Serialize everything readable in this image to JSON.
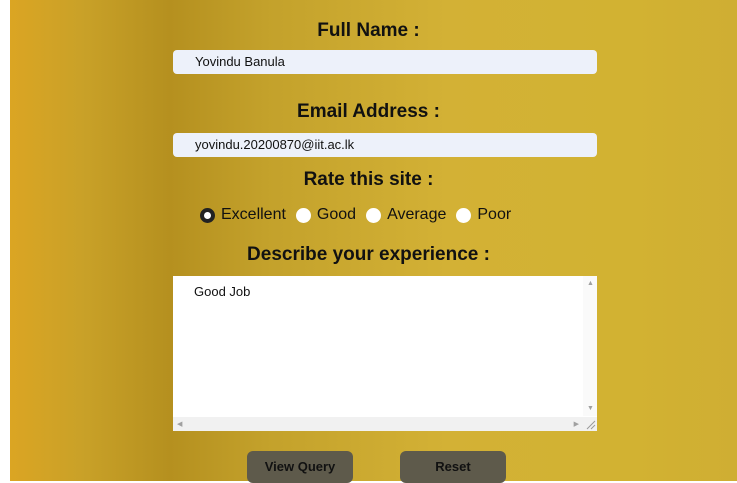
{
  "form": {
    "full_name_label": "Full Name :",
    "full_name_value": "Yovindu Banula",
    "email_label": "Email Address :",
    "email_value": "yovindu.20200870@iit.ac.lk",
    "rating_label": "Rate this site :",
    "rating_options": [
      "Excellent",
      "Good",
      "Average",
      "Poor"
    ],
    "rating_selected": "Excellent",
    "experience_label": "Describe your experience :",
    "experience_value": "Good Job",
    "view_query_label": "View Query",
    "reset_label": "Reset"
  },
  "colors": {
    "background_gold": "#d3b135",
    "field_bg": "#edf1fa",
    "button_bg": "#5e5a4b"
  }
}
